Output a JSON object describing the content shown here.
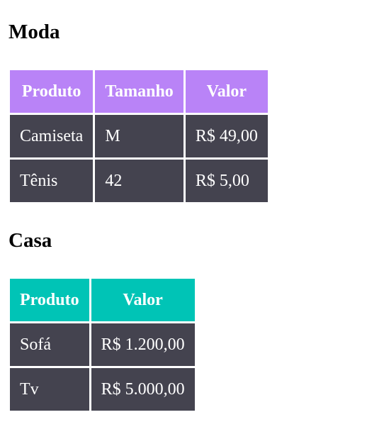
{
  "sections": [
    {
      "title": "Moda",
      "headers": [
        "Produto",
        "Tamanho",
        "Valor"
      ],
      "rows": [
        [
          "Camiseta",
          "M",
          "R$ 49,00"
        ],
        [
          "Tênis",
          "42",
          "R$ 5,00"
        ]
      ]
    },
    {
      "title": "Casa",
      "headers": [
        "Produto",
        "Valor"
      ],
      "rows": [
        [
          "Sofá",
          "R$ 1.200,00"
        ],
        [
          "Tv",
          "R$ 5.000,00"
        ]
      ]
    }
  ],
  "colors": {
    "moda_header": "#b983f7",
    "casa_header": "#00c4b6",
    "cell_background": "#44434f",
    "cell_text": "#ffffff"
  }
}
